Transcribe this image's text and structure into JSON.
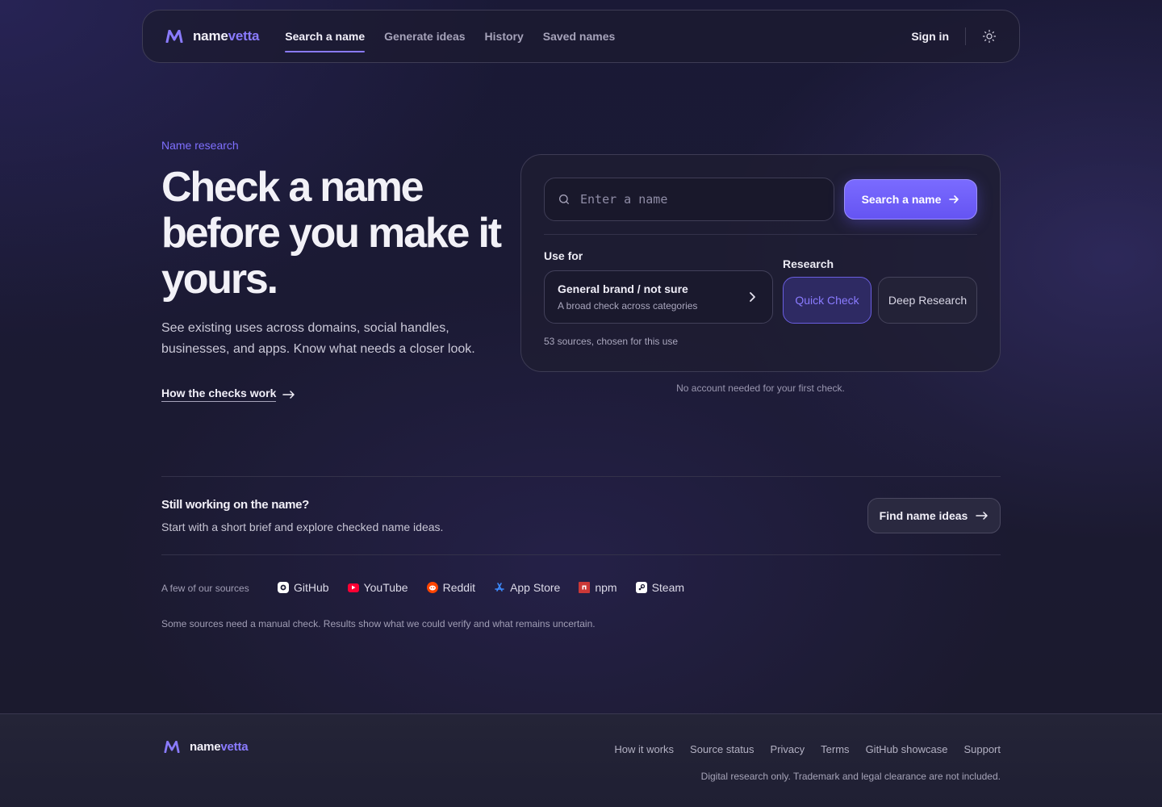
{
  "brand": {
    "name_part1": "name",
    "name_part2": "vetta",
    "accent": "#8a7bff"
  },
  "nav": {
    "links": [
      {
        "label": "Search a name",
        "active": true
      },
      {
        "label": "Generate ideas",
        "active": false
      },
      {
        "label": "History",
        "active": false
      },
      {
        "label": "Saved names",
        "active": false
      }
    ],
    "sign_in": "Sign in",
    "theme_icon": "sun-icon"
  },
  "hero": {
    "eyebrow": "Name research",
    "title": "Check a name before you make it yours.",
    "subtitle": "See existing uses across domains, social handles, businesses, and apps. Know what needs a closer look.",
    "link": "How the checks work"
  },
  "search": {
    "placeholder": "Enter a name",
    "button": "Search a name",
    "use_for_label": "Use for",
    "use_for_value": "General brand / not sure",
    "use_for_desc": "A broad check across categories",
    "research_label": "Research",
    "modes": [
      {
        "label": "Quick Check",
        "selected": true
      },
      {
        "label": "Deep Research",
        "selected": false
      }
    ],
    "sources_note": "53 sources, chosen for this use",
    "no_account": "No account needed for your first check."
  },
  "ideas": {
    "title": "Still working on the name?",
    "subtitle": "Start with a short brief and explore checked name ideas.",
    "button": "Find name ideas"
  },
  "sources": {
    "label": "A few of our sources",
    "items": [
      {
        "name": "GitHub",
        "icon": "github-icon",
        "color": "#ffffff"
      },
      {
        "name": "YouTube",
        "icon": "youtube-icon",
        "color": "#ff0033"
      },
      {
        "name": "Reddit",
        "icon": "reddit-icon",
        "color": "#ff4500"
      },
      {
        "name": "App Store",
        "icon": "app-store-icon",
        "color": "#1e90ff"
      },
      {
        "name": "npm",
        "icon": "npm-icon",
        "color": "#cb3837"
      },
      {
        "name": "Steam",
        "icon": "steam-icon",
        "color": "#ffffff"
      }
    ],
    "disclaimer": "Some sources need a manual check. Results show what we could verify and what remains uncertain."
  },
  "footer": {
    "links": [
      "How it works",
      "Source status",
      "Privacy",
      "Terms",
      "GitHub showcase",
      "Support"
    ],
    "note": "Digital research only. Trademark and legal clearance are not included."
  }
}
